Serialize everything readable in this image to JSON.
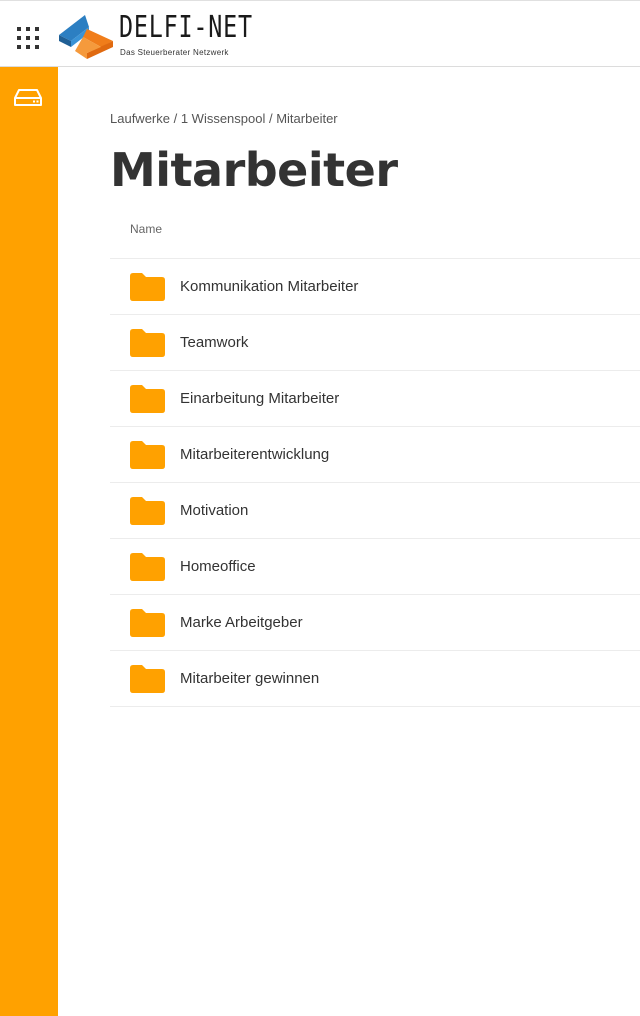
{
  "header": {
    "apps_icon": "apps-grid-icon",
    "logo": {
      "title": "DELFI-NET",
      "subtitle": "Das Steuerberater Netzwerk",
      "colors": {
        "blue": "#2c7fc2",
        "orange": "#f07d1a"
      }
    }
  },
  "sidebar": {
    "background": "#ffa100",
    "items": [
      {
        "icon": "drive-icon",
        "label": ""
      }
    ]
  },
  "breadcrumb": {
    "items": [
      "Laufwerke",
      "1 Wissenspool",
      "Mitarbeiter"
    ],
    "separator": " / "
  },
  "page": {
    "title": "Mitarbeiter"
  },
  "table": {
    "column_name": "Name",
    "folder_color": "#ffa100",
    "rows": [
      {
        "name": "Kommunikation Mitarbeiter",
        "icon": "folder-icon"
      },
      {
        "name": "Teamwork",
        "icon": "folder-icon"
      },
      {
        "name": "Einarbeitung Mitarbeiter",
        "icon": "folder-icon"
      },
      {
        "name": "Mitarbeiterentwicklung",
        "icon": "folder-icon"
      },
      {
        "name": "Motivation",
        "icon": "folder-icon"
      },
      {
        "name": "Homeoffice",
        "icon": "folder-icon"
      },
      {
        "name": "Marke Arbeitgeber",
        "icon": "folder-icon"
      },
      {
        "name": "Mitarbeiter gewinnen",
        "icon": "folder-icon"
      }
    ]
  }
}
